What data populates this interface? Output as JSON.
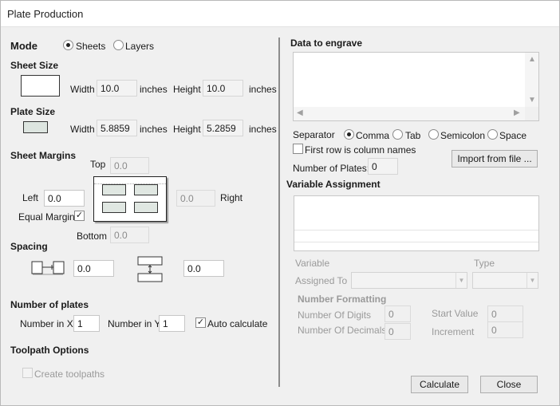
{
  "window": {
    "title": "Plate Production"
  },
  "mode": {
    "label": "Mode",
    "options": [
      "Sheets",
      "Layers"
    ],
    "selected": "Sheets"
  },
  "sheet_size": {
    "label": "Sheet Size",
    "width_label": "Width",
    "width": "10.0",
    "width_unit": "inches",
    "height_label": "Height",
    "height": "10.0",
    "height_unit": "inches"
  },
  "plate_size": {
    "label": "Plate Size",
    "width_label": "Width",
    "width": "5.8859",
    "width_unit": "inches",
    "height_label": "Height",
    "height": "5.2859",
    "height_unit": "inches"
  },
  "sheet_margins": {
    "label": "Sheet Margins",
    "top_label": "Top",
    "top": "0.0",
    "left_label": "Left",
    "left": "0.0",
    "right_label": "Right",
    "right": "0.0",
    "bottom_label": "Bottom",
    "bottom": "0.0",
    "equal_label": "Equal Margins",
    "equal_checked": true
  },
  "spacing": {
    "label": "Spacing",
    "horizontal": "0.0",
    "vertical": "0.0"
  },
  "num_plates": {
    "label": "Number of plates",
    "x_label": "Number in X",
    "x": "1",
    "y_label": "Number in Y",
    "y": "1",
    "auto_label": "Auto calculate",
    "auto_checked": true
  },
  "toolpath": {
    "label": "Toolpath Options",
    "create_label": "Create toolpaths",
    "create_checked": false
  },
  "engrave": {
    "label": "Data to engrave",
    "separator_label": "Separator",
    "separators": [
      "Comma",
      "Tab",
      "Semicolon",
      "Space"
    ],
    "separator_selected": "Comma",
    "first_row_label": "First row is column names",
    "first_row_checked": false,
    "num_plates_label": "Number of Plates:",
    "num_plates": "0",
    "import_label": "Import from file ..."
  },
  "variable_assignment": {
    "label": "Variable Assignment",
    "variable_label": "Variable",
    "type_label": "Type",
    "assigned_label": "Assigned To",
    "assigned_value": "",
    "type_value": ""
  },
  "number_formatting": {
    "label": "Number Formatting",
    "digits_label": "Number Of Digits",
    "digits": "0",
    "decimals_label": "Number Of Decimals",
    "decimals": "0",
    "start_label": "Start Value",
    "start": "0",
    "increment_label": "Increment",
    "increment": "0"
  },
  "buttons": {
    "calculate": "Calculate",
    "close": "Close"
  },
  "icons": {
    "radio": "radio-button",
    "checkbox": "checkbox",
    "scroll_up": "arrow-up-icon",
    "scroll_down": "arrow-down-icon",
    "scroll_left": "arrow-left-icon",
    "scroll_right": "arrow-right-icon",
    "dropdown": "chevron-down-icon"
  }
}
